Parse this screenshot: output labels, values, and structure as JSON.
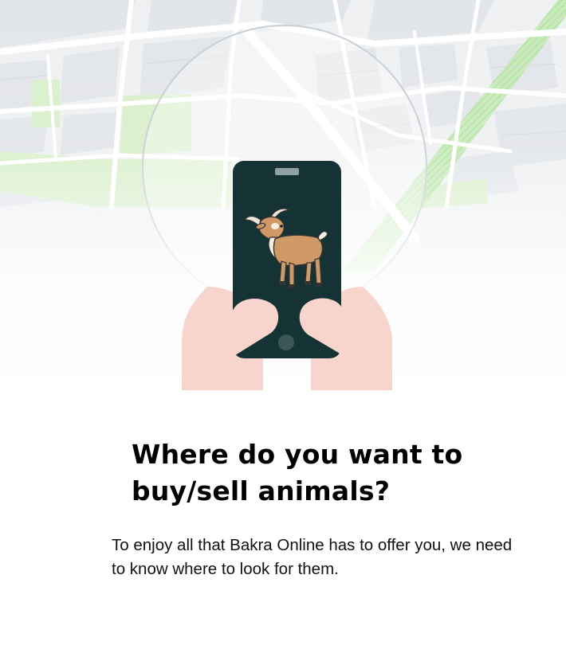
{
  "onboarding": {
    "title": "Where do you want to buy/sell animals?",
    "description": "To enjoy all that Bakra Online has to offer you, we need to know where to look for them."
  },
  "illustration": {
    "background": "map-icon",
    "device": "smartphone-icon",
    "animal": "goat-icon",
    "colors": {
      "phone_body": "#153234",
      "hands": "#f8d5cc",
      "map_roads": "#ffffff",
      "map_blocks": "#e6e9ec",
      "map_parks": "#d8ecc7",
      "map_river": "#a8e4a0",
      "goat_fur": "#cf9a66"
    }
  }
}
